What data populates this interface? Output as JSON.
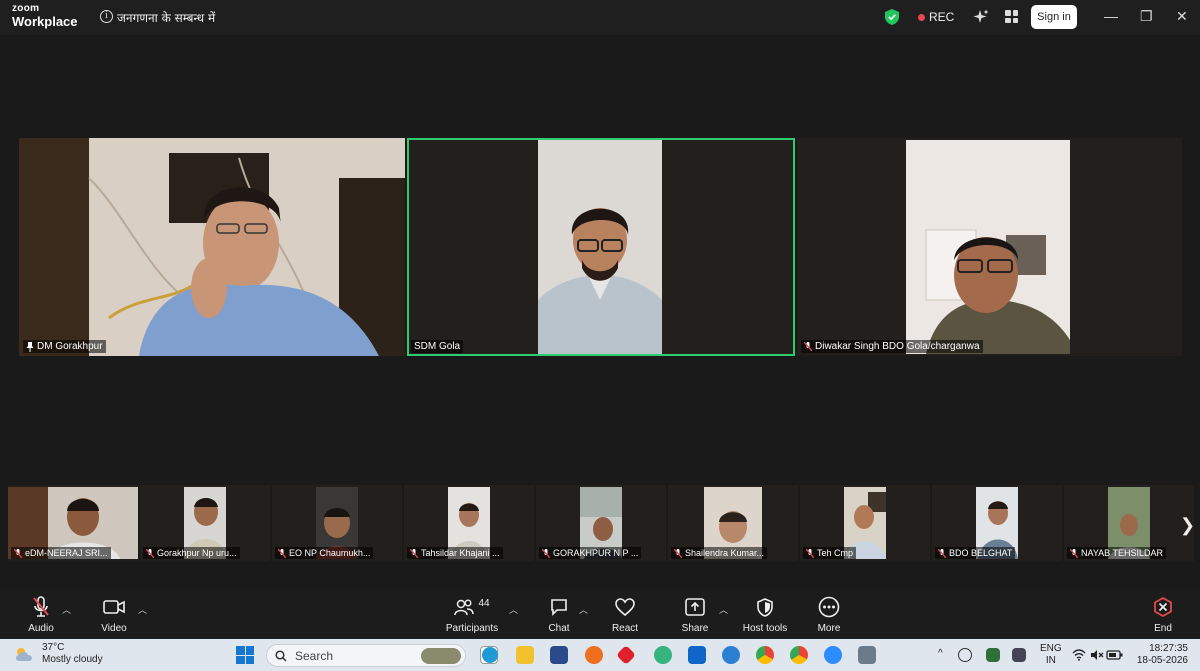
{
  "titlebar": {
    "brand_top": "zoom",
    "brand_bottom": "Workplace",
    "meeting_title": "जनगणना के सम्बन्ध में",
    "rec_label": "REC",
    "signin_label": "Sign in",
    "minimize": "—",
    "restore": "❐",
    "close": "✕"
  },
  "main_tiles": [
    {
      "name": "DM Gorakhpur",
      "pinned": true
    },
    {
      "name": "SDM Gola",
      "active": true
    },
    {
      "name": "Diwakar Singh BDO Gola/charganwa",
      "muted": true
    }
  ],
  "thumbnails": [
    {
      "name": "eDM-NEERAJ SRI..."
    },
    {
      "name": "Gorakhpur Np uru..."
    },
    {
      "name": "EO NP Chaumukh..."
    },
    {
      "name": "Tahsildar Khajani ..."
    },
    {
      "name": "GORAKHPUR N P ..."
    },
    {
      "name": "Shailendra Kumar..."
    },
    {
      "name": "Teh Cmp"
    },
    {
      "name": "BDO BELGHAT"
    },
    {
      "name": "NAYAB TEHSILDAR"
    }
  ],
  "toolbar": {
    "audio": "Audio",
    "video": "Video",
    "participants": "Participants",
    "participants_count": "44",
    "chat": "Chat",
    "react": "React",
    "share": "Share",
    "host_tools": "Host tools",
    "more": "More",
    "end": "End"
  },
  "taskbar": {
    "temperature": "37°C",
    "weather": "Mostly cloudy",
    "search_placeholder": "Search",
    "lang_top": "ENG",
    "lang_bottom": "IN",
    "time": "18:27:35",
    "date": "18-05-2026"
  },
  "colors": {
    "active_border": "#2ecc71",
    "rec_dot": "#e5484d",
    "end_red": "#e5484d"
  }
}
